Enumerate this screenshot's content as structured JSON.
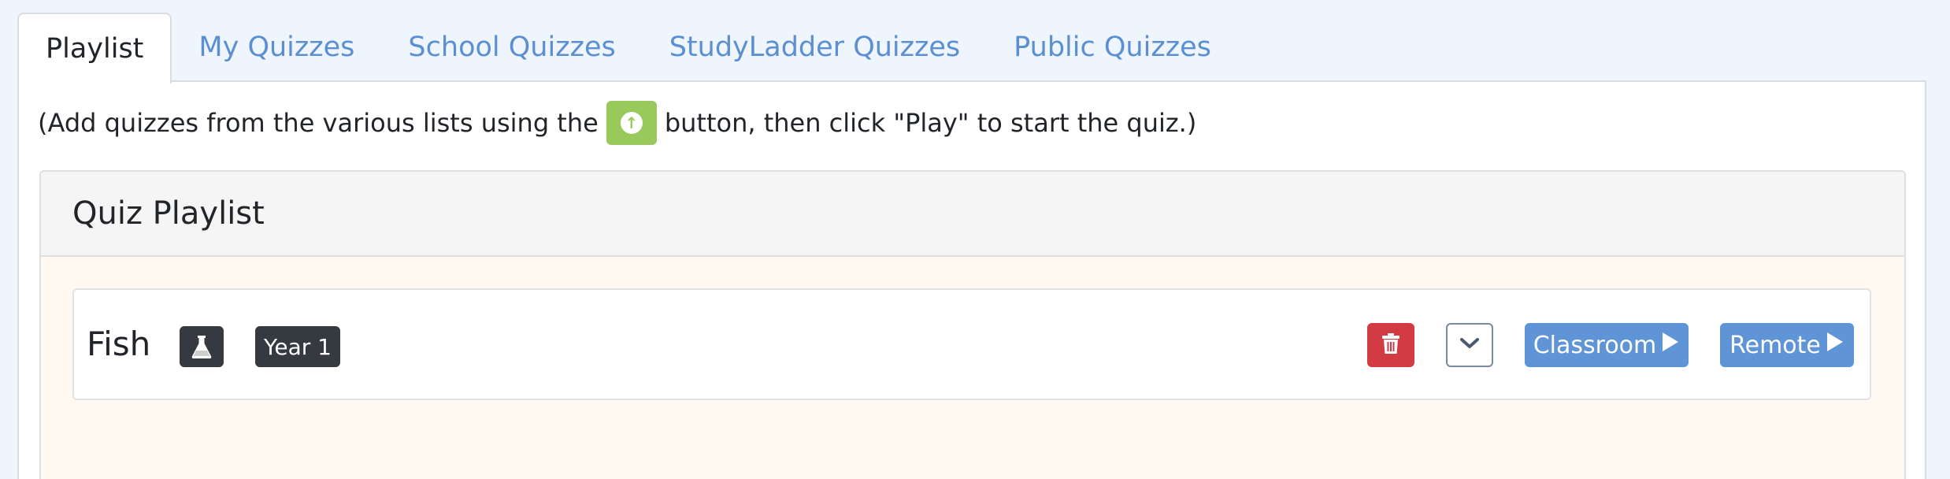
{
  "tabs": [
    {
      "label": "Playlist",
      "active": true
    },
    {
      "label": "My Quizzes"
    },
    {
      "label": "School Quizzes"
    },
    {
      "label": "StudyLadder Quizzes"
    },
    {
      "label": "Public Quizzes"
    }
  ],
  "hint": {
    "before": "(Add quizzes from the various lists using the",
    "after": "button, then click \"Play\" to start the quiz.)",
    "button_icon": "arrow-up-circle-icon"
  },
  "playlist": {
    "title": "Quiz Playlist",
    "items": [
      {
        "title": "Fish",
        "subject_icon": "flask-icon",
        "year": "Year 1",
        "classroom_label": "Classroom",
        "remote_label": "Remote"
      }
    ]
  },
  "colors": {
    "page_bg": "#eef5fc",
    "tab_link": "#5b8fd1",
    "add_button": "#9ac95b",
    "delete_button": "#d23a44",
    "play_button": "#5f94d7",
    "badge_dark": "#343a40",
    "playlist_body_bg": "#fff9f2"
  }
}
